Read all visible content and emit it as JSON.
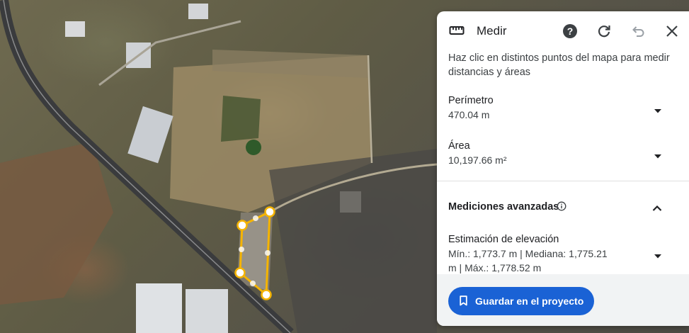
{
  "panel": {
    "title": "Medir",
    "icons": [
      "ruler-icon",
      "help-icon",
      "refresh-icon",
      "undo-icon",
      "close-icon"
    ],
    "description": "Haz clic en distintos puntos del mapa para medir distancias y áreas",
    "perimeter": {
      "label": "Perímetro",
      "value": "470.04 m"
    },
    "area": {
      "label": "Área",
      "value": "10,197.66 m²"
    },
    "advanced": {
      "title": "Mediciones avanzadas",
      "elevation_label": "Estimación de elevación",
      "elevation_value": "Mín.: 1,773.7 m | Mediana: 1,775.21 m | Máx.: 1,778.52 m"
    },
    "save_button": "Guardar en el proyecto"
  },
  "colors": {
    "accent": "#1a62d5",
    "polygon": "#f5b400",
    "panel_bg": "#ffffff"
  }
}
